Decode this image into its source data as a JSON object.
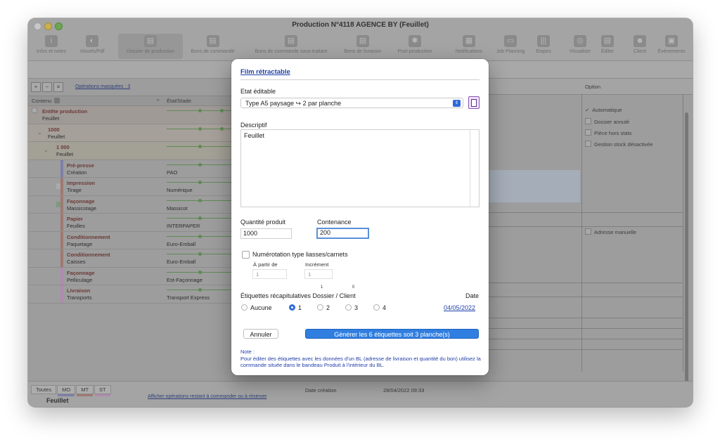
{
  "window": {
    "title": "Production N°4118 AGENCE BY (Feuillet)"
  },
  "toolbar": {
    "items": [
      {
        "label": "Infos et notes",
        "icon": "info-icon"
      },
      {
        "label": "Visuels/Pdf",
        "icon": "image-icon"
      },
      {
        "label": "Dossier de production",
        "icon": "folder-icon"
      },
      {
        "label": "Bons de commande",
        "icon": "order-icon"
      },
      {
        "label": "Bons de commande sous-traitant",
        "icon": "subcontract-icon"
      },
      {
        "label": "Bons de livraison",
        "icon": "delivery-icon"
      },
      {
        "label": "Post-production",
        "icon": "postprod-icon"
      },
      {
        "label": "Notifications",
        "icon": "notification-icon"
      },
      {
        "label": "Job Planning",
        "icon": "calendar-icon"
      },
      {
        "label": "Etapes",
        "icon": "steps-icon"
      },
      {
        "label": "Visualiser",
        "icon": "eye-icon"
      },
      {
        "label": "Éditer",
        "icon": "edit-icon"
      },
      {
        "label": "Client",
        "icon": "client-icon"
      },
      {
        "label": "Évènements",
        "icon": "events-icon"
      }
    ]
  },
  "left_panel": {
    "masked_link": "Opérations masquées : 3",
    "col_contenu": "Contenu",
    "col_etat": "État/Stade",
    "rows": [
      {
        "l1": "Entête production",
        "l2": "Feuillet",
        "etat": ""
      },
      {
        "l1": "1000",
        "l2": "Feuillet",
        "etat": ""
      },
      {
        "l1": "1 000",
        "l2": "Feuillet",
        "etat": ""
      },
      {
        "l1": "Pré-presse",
        "l2": "Création",
        "etat": "PAO"
      },
      {
        "l1": "Impression",
        "l2": "Tirage",
        "etat": "Numérique"
      },
      {
        "l1": "Façonnage",
        "l2": "Massicotage",
        "etat": "Massicot"
      },
      {
        "l1": "Papier",
        "l2": "Feuilles",
        "etat": "INTERPAPER"
      },
      {
        "l1": "Conditionnement",
        "l2": "Paquetage",
        "etat": "Euro-Emball"
      },
      {
        "l1": "Conditionnement",
        "l2": "Caisses",
        "etat": "Euro-Emball"
      },
      {
        "l1": "Façonnage",
        "l2": "Pelliculage",
        "etat": "Est-Façonnage"
      },
      {
        "l1": "Livraison",
        "l2": "Transports",
        "etat": "Transport Express"
      }
    ]
  },
  "right_panel": {
    "header": "Option",
    "options": [
      {
        "label": "Automatique",
        "checked": true
      },
      {
        "label": "Dossier annulé",
        "checked": false
      },
      {
        "label": "Pièce hors stats",
        "checked": false
      },
      {
        "label": "Gestion stock désactivée",
        "checked": false
      }
    ],
    "adresse_manuelle": "Adresse manuelle"
  },
  "bottom": {
    "tabs": [
      "Toutes",
      "MO",
      "MT",
      "ST"
    ],
    "link": "Afficher opérations restant à commander ou à réserver",
    "date_label": "Date création",
    "date_value": "28/04/2022 09:33",
    "status": "Feuillet"
  },
  "modal": {
    "title": "Film rétractable",
    "etat_label": "Etat éditable",
    "etat_value": "Type A5 paysage ↪ 2 par planche",
    "descriptif_label": "Descriptif",
    "descriptif_value": "Feuillet",
    "quantite_label": "Quantité produit",
    "quantite_value": "1000",
    "contenance_label": "Contenance",
    "contenance_value": "200",
    "numerotation_label": "Numérotation type liasses/carnets",
    "a_partir_label": "À partir de",
    "a_partir_value": "1",
    "increment_label": "Incrément",
    "increment_value": "1",
    "etiquettes_label": "Étiquettes récapitulatives Dossier / Client",
    "superscript_dossier": "1",
    "superscript_client": "0",
    "date_label": "Date",
    "date_value": "04/05/2022",
    "radio_options": [
      "Aucune",
      "1",
      "2",
      "3",
      "4"
    ],
    "radio_selected": "1",
    "cancel_label": "Annuler",
    "generate_label": "Générer les 6 étiquettes soit 3 planche(s)",
    "note_title": "Note :",
    "note_text": "Pour éditer des étiquettes avec les données d'un BL (adresse de livraison et quantité du bon) utilisez la commande située dans le bandeau Produit à l'intérieur du BL."
  }
}
